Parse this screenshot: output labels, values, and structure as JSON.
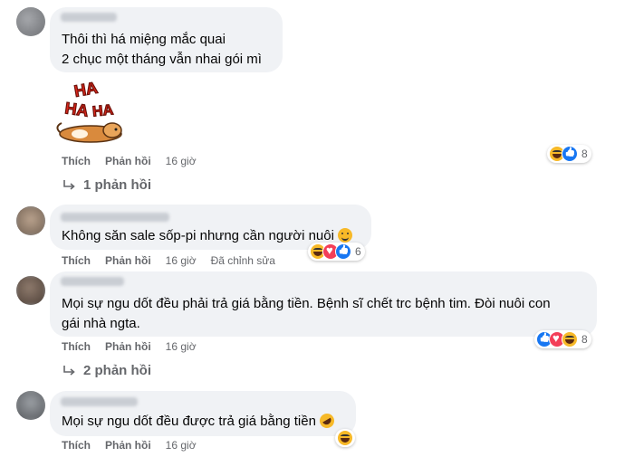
{
  "actions": {
    "like": "Thích",
    "reply": "Phản hồi"
  },
  "colors": {
    "haha": "#f7b928",
    "like": "#1877f2",
    "love": "#f33e58",
    "bubble": "#f0f2f5",
    "muted": "#65676b"
  },
  "comments": [
    {
      "lines": [
        "Thôi thì há miệng mắc quai",
        "2 chục một tháng vẫn nhai gói mì"
      ],
      "sticker": {
        "text_top": "HA",
        "text_bottom": "HA",
        "text_mid": "HA",
        "icon": "haha-dog-sticker"
      },
      "time": "16 giờ",
      "reaction_icons": [
        "haha",
        "like"
      ],
      "reaction_count": "8",
      "replies": "1 phản hồi"
    },
    {
      "lines": [
        "Không săn sale sốp-pi nhưng cần người nuôi"
      ],
      "time": "16 giờ",
      "edited": "Đã chỉnh sửa",
      "reaction_icons": [
        "haha",
        "love",
        "like"
      ],
      "reaction_count": "6"
    },
    {
      "lines": [
        "Mọi sự ngu dốt đều phải trả giá bằng tiền. Bệnh sĩ chết trc bệnh tim. Đòi nuôi con",
        "gái nhà ngta."
      ],
      "time": "16 giờ",
      "reaction_icons": [
        "like",
        "love",
        "haha"
      ],
      "reaction_count": "8",
      "replies": "2 phản hồi"
    },
    {
      "lines": [
        "Mọi sự ngu dốt đều được trả giá bằng tiền"
      ],
      "time": "16 giờ",
      "reaction_icons": [
        "haha"
      ]
    }
  ]
}
